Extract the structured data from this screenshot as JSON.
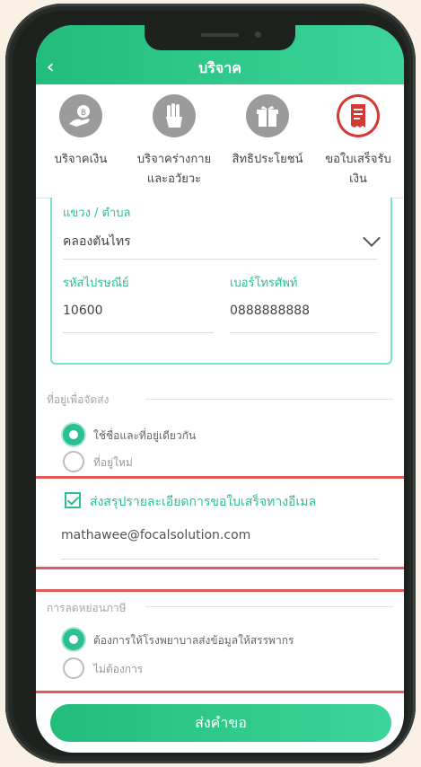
{
  "header": {
    "title": "บริจาค",
    "back_icon": "back-arrow-icon"
  },
  "tabs": [
    {
      "label": "บริจาคเงิน",
      "icon": "hand-coin-icon"
    },
    {
      "label": "บริจาคร่างกาย\nและอวัยวะ",
      "icon": "hand-organ-icon"
    },
    {
      "label": "สิทธิประโยชน์",
      "icon": "gift-icon"
    },
    {
      "label": "ขอใบเสร็จรับ\nเงิน",
      "icon": "receipt-icon",
      "active": true
    }
  ],
  "address": {
    "subdistrict_label": "แขวง / ตำบล",
    "subdistrict_value": "คลองตันไทร",
    "postcode_label": "รหัสไปรษณีย์",
    "postcode_value": "10600",
    "phone_label": "เบอร์โทรศัพท์",
    "phone_value": "0888888888"
  },
  "shipping": {
    "header": "ที่อยู่เพื่อจัดส่ง",
    "options": [
      {
        "label": "ใช้ชื่อและที่อยู่เดียวกัน",
        "selected": true
      },
      {
        "label": "ที่อยู่ใหม่",
        "selected": false
      }
    ]
  },
  "email_receipt": {
    "label": "ส่งสรุปรายละเอียดการขอใบเสร็จทางอีเมล",
    "checked": true,
    "email": "mathawee@focalsolution.com"
  },
  "tax": {
    "header": "การลดหย่อนภาษี",
    "options": [
      {
        "label": "ต้องการให้โรงพยาบาลส่งข้อมูลให้สรรพากร",
        "selected": true
      },
      {
        "label": "ไม่ต้องการ",
        "selected": false
      }
    ]
  },
  "submit_label": "ส่งคำขอ",
  "colors": {
    "accent": "#2bbf94",
    "highlight": "#e25a5c"
  }
}
